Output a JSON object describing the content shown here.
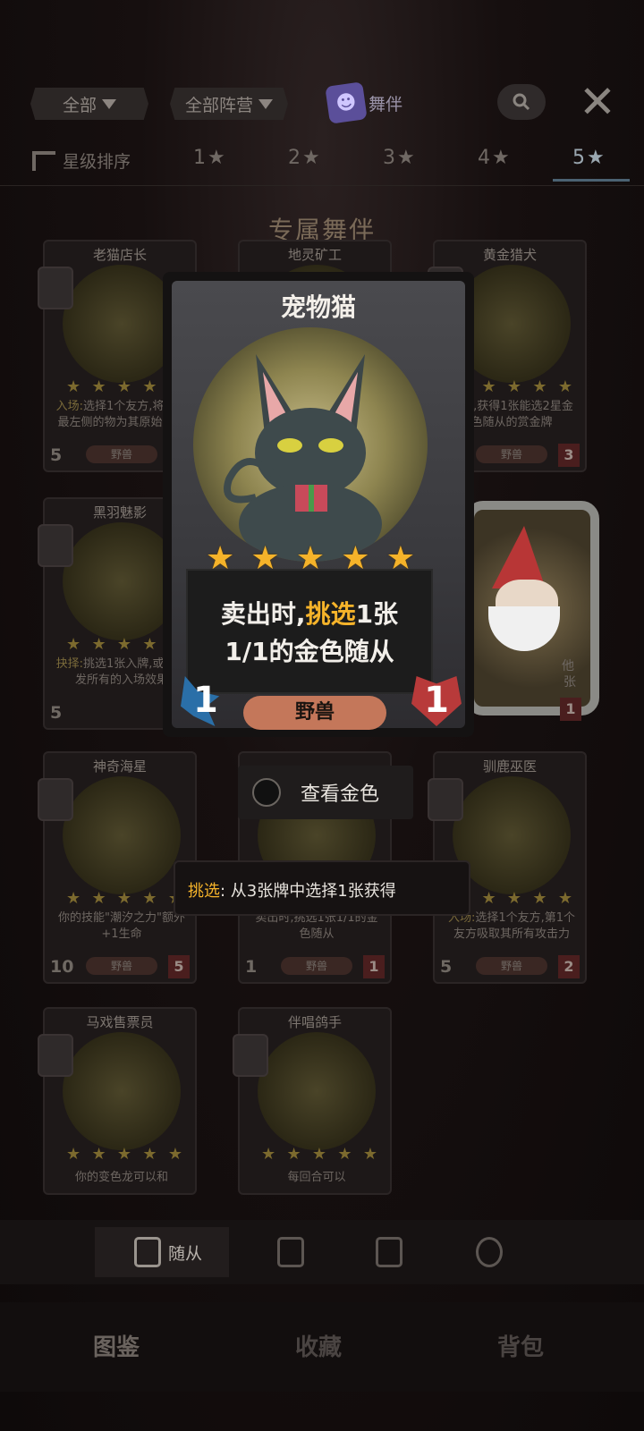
{
  "filters": {
    "all": "全部",
    "all_factions": "全部阵营",
    "companion": "舞伴"
  },
  "star_row": {
    "sort_label": "星级排序",
    "tabs": [
      "1",
      "2",
      "3",
      "4",
      "5"
    ],
    "active_tab": "5"
  },
  "section_title": "专属舞伴",
  "cards": [
    {
      "name": "老猫店长",
      "desc_hl": "入场:",
      "desc": "选择1个友方,将商店最左侧的物为其原始复制",
      "attack": "5",
      "tribe": "野兽",
      "hp": ""
    },
    {
      "name": "地灵矿工",
      "desc_hl": "",
      "desc": "",
      "attack": "",
      "tribe": "",
      "hp": ""
    },
    {
      "name": "黄金猎犬",
      "desc_hl": "",
      "desc": "出时,获得1张能选2星金色随从的赏金牌",
      "attack": "",
      "tribe": "野兽",
      "hp": "3"
    },
    {
      "name": "黑羽魅影",
      "desc_hl": "抉择:",
      "desc": "挑选1张入牌,或者触发所有的入场效果",
      "attack": "5",
      "tribe": "",
      "hp": ""
    },
    {
      "name": "神奇海星",
      "desc_hl": "",
      "desc": "你的技能\"潮汐之力\"额外+1生命",
      "attack": "10",
      "tribe": "野兽",
      "hp": "5"
    },
    {
      "name": "宠物猫",
      "desc_hl": "挑选",
      "desc": "卖出时,挑选1张1/1的金色随从",
      "attack": "1",
      "tribe": "野兽",
      "hp": "1"
    },
    {
      "name": "驯鹿巫医",
      "desc_hl": "入场:",
      "desc": "选择1个友方,第1个友方吸取其所有攻击力",
      "attack": "5",
      "tribe": "野兽",
      "hp": "2"
    },
    {
      "name": "马戏售票员",
      "desc_hl": "",
      "desc": "你的变色龙可以和",
      "attack": "",
      "tribe": "",
      "hp": ""
    },
    {
      "name": "伴唱鸽手",
      "desc_hl": "",
      "desc": "每回合可以",
      "attack": "",
      "tribe": "",
      "hp": ""
    }
  ],
  "feature_card": {
    "name": "宠物猫",
    "desc_before": "卖出时,",
    "desc_hl": "挑选",
    "desc_after": "1张",
    "desc_line2": "1/1的金色随从",
    "attack": "1",
    "hp": "1",
    "tribe": "野兽",
    "stars": 5
  },
  "gnome_card": {
    "partial_text": "他",
    "partial_text2": "张",
    "hp": "1"
  },
  "view_gold": {
    "label": "查看金色"
  },
  "tooltip": {
    "keyword": "挑选",
    "text": ": 从3张牌中选择1张获得"
  },
  "sub_tabs": [
    {
      "label": "随从",
      "active": true
    },
    {
      "label": "",
      "active": false
    },
    {
      "label": "",
      "active": false
    },
    {
      "label": "",
      "active": false
    }
  ],
  "main_tabs": [
    {
      "label": "图鉴",
      "active": true
    },
    {
      "label": "收藏",
      "active": false
    },
    {
      "label": "背包",
      "active": false
    }
  ],
  "colors": {
    "star_gold": "#f5b32a",
    "highlight": "#f5b32a",
    "hp_red": "#b83a3a",
    "attack_blue": "#2a6fa8",
    "tribe_pill": "#c4775a"
  }
}
